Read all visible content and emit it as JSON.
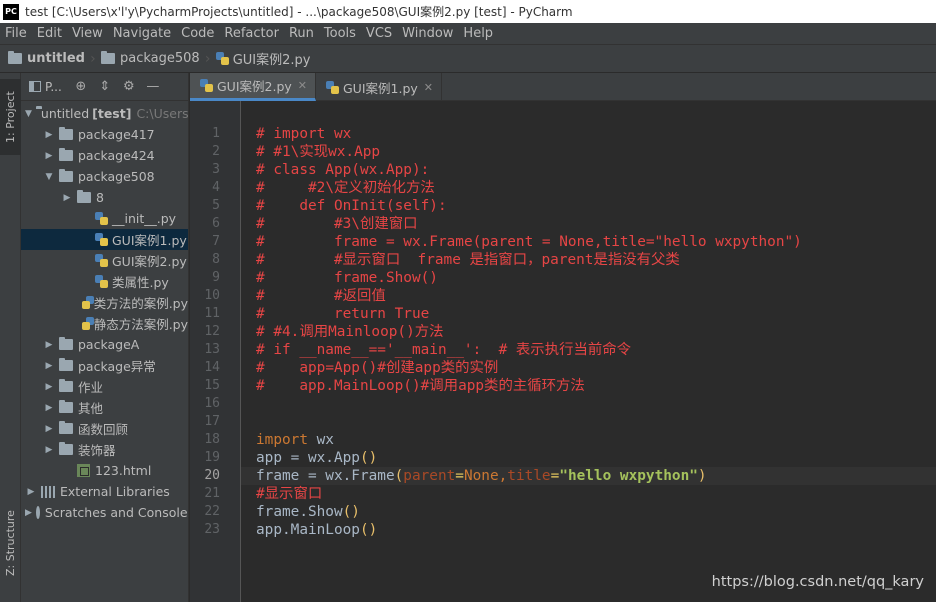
{
  "window": {
    "title": "test [C:\\Users\\x'l'y\\PycharmProjects\\untitled] - ...\\package508\\GUI案例2.py [test] - PyCharm",
    "app_icon_text": "PC"
  },
  "menu": [
    "File",
    "Edit",
    "View",
    "Navigate",
    "Code",
    "Refactor",
    "Run",
    "Tools",
    "VCS",
    "Window",
    "Help"
  ],
  "breadcrumb": [
    "untitled",
    "package508",
    "GUI案例2.py"
  ],
  "left_strip": {
    "project_tab": "1: Project",
    "structure_tab": "Z: Structure"
  },
  "project_panel": {
    "title": "P..."
  },
  "tree": [
    {
      "label": "untitled",
      "extra": "[test]",
      "muted": "C:\\Users",
      "indent": 0,
      "arrow": "down",
      "icon": "folder"
    },
    {
      "label": "package417",
      "indent": 1,
      "arrow": "right",
      "icon": "folder"
    },
    {
      "label": "package424",
      "indent": 1,
      "arrow": "right",
      "icon": "folder"
    },
    {
      "label": "package508",
      "indent": 1,
      "arrow": "down",
      "icon": "folder"
    },
    {
      "label": "8",
      "indent": 2,
      "arrow": "right",
      "icon": "folder"
    },
    {
      "label": "__init__.py",
      "indent": 3,
      "arrow": "",
      "icon": "py"
    },
    {
      "label": "GUI案例1.py",
      "indent": 3,
      "arrow": "",
      "icon": "py",
      "selected": true
    },
    {
      "label": "GUI案例2.py",
      "indent": 3,
      "arrow": "",
      "icon": "py"
    },
    {
      "label": "类属性.py",
      "indent": 3,
      "arrow": "",
      "icon": "py"
    },
    {
      "label": "类方法的案例.py",
      "indent": 3,
      "arrow": "",
      "icon": "py"
    },
    {
      "label": "静态方法案例.py",
      "indent": 3,
      "arrow": "",
      "icon": "py"
    },
    {
      "label": "packageA",
      "indent": 1,
      "arrow": "right",
      "icon": "folder"
    },
    {
      "label": "package异常",
      "indent": 1,
      "arrow": "right",
      "icon": "folder"
    },
    {
      "label": "作业",
      "indent": 1,
      "arrow": "right",
      "icon": "folder"
    },
    {
      "label": "其他",
      "indent": 1,
      "arrow": "right",
      "icon": "folder"
    },
    {
      "label": "函数回顾",
      "indent": 1,
      "arrow": "right",
      "icon": "folder"
    },
    {
      "label": "装饰器",
      "indent": 1,
      "arrow": "right",
      "icon": "folder"
    },
    {
      "label": "123.html",
      "indent": 2,
      "arrow": "",
      "icon": "html"
    },
    {
      "label": "External Libraries",
      "indent": 0,
      "arrow": "right",
      "icon": "lib"
    },
    {
      "label": "Scratches and Consoles",
      "indent": 0,
      "arrow": "right",
      "icon": "scratch"
    }
  ],
  "editor_tabs": [
    {
      "label": "GUI案例2.py",
      "active": true
    },
    {
      "label": "GUI案例1.py",
      "active": false
    }
  ],
  "editor": {
    "current_line": 20,
    "lines": [
      [
        {
          "t": "# import wx",
          "c": "cm"
        }
      ],
      [
        {
          "t": "# #1\\实现wx.App",
          "c": "cm"
        }
      ],
      [
        {
          "t": "# class App(wx.App):",
          "c": "cm"
        }
      ],
      [
        {
          "t": "#",
          "c": "cm"
        },
        {
          "t": "     ",
          "c": "dots"
        },
        {
          "t": "#2\\定义初始化方法",
          "c": "cm"
        }
      ],
      [
        {
          "t": "#",
          "c": "cm"
        },
        {
          "t": "    ",
          "c": "dots"
        },
        {
          "t": "def OnInit(self):",
          "c": "cm"
        }
      ],
      [
        {
          "t": "#",
          "c": "cm"
        },
        {
          "t": "        ",
          "c": "dots"
        },
        {
          "t": "#3\\创建窗口",
          "c": "cm"
        }
      ],
      [
        {
          "t": "#",
          "c": "cm"
        },
        {
          "t": "        ",
          "c": "dots"
        },
        {
          "t": "frame = wx.Frame(parent = None,title=\"hello wxpython\")",
          "c": "cm"
        }
      ],
      [
        {
          "t": "#",
          "c": "cm"
        },
        {
          "t": "        ",
          "c": "dots"
        },
        {
          "t": "#显示窗口  frame 是指窗口，parent是指没有父类",
          "c": "cm"
        }
      ],
      [
        {
          "t": "#",
          "c": "cm"
        },
        {
          "t": "        ",
          "c": "dots"
        },
        {
          "t": "frame.Show()",
          "c": "cm"
        }
      ],
      [
        {
          "t": "#",
          "c": "cm"
        },
        {
          "t": "        ",
          "c": "dots"
        },
        {
          "t": "#返回值",
          "c": "cm"
        }
      ],
      [
        {
          "t": "#",
          "c": "cm"
        },
        {
          "t": "        ",
          "c": "dots"
        },
        {
          "t": "return True",
          "c": "cm"
        }
      ],
      [
        {
          "t": "# #4.调用Mainloop()方法",
          "c": "cm"
        }
      ],
      [
        {
          "t": "# if __name__=='__main__':  # 表示执行当前命令",
          "c": "cm"
        }
      ],
      [
        {
          "t": "#",
          "c": "cm"
        },
        {
          "t": "    ",
          "c": "dots"
        },
        {
          "t": "app=App()#创建app类的实例",
          "c": "cm"
        }
      ],
      [
        {
          "t": "#",
          "c": "cm"
        },
        {
          "t": "    ",
          "c": "dots"
        },
        {
          "t": "app.MainLoop()#调用app类的主循环方法",
          "c": "cm"
        }
      ],
      [],
      [],
      [
        {
          "t": "import",
          "c": "kw"
        },
        {
          "t": " wx",
          "c": ""
        }
      ],
      [
        {
          "t": "app = wx.App",
          "c": ""
        },
        {
          "t": "()",
          "c": "paren"
        }
      ],
      [
        {
          "t": "frame = wx.Frame",
          "c": ""
        },
        {
          "t": "(",
          "c": "paren"
        },
        {
          "t": "parent",
          "c": "prm"
        },
        {
          "t": "=",
          "c": "eq"
        },
        {
          "t": "None",
          "c": "kw"
        },
        {
          "t": ",",
          "c": "kw"
        },
        {
          "t": "title",
          "c": "prm"
        },
        {
          "t": "=",
          "c": "eq"
        },
        {
          "t": "\"hello wxpython\"",
          "c": "str"
        },
        {
          "t": ")",
          "c": "paren"
        }
      ],
      [
        {
          "t": "#显示窗口",
          "c": "cm"
        }
      ],
      [
        {
          "t": "frame.Show",
          "c": ""
        },
        {
          "t": "()",
          "c": "paren"
        }
      ],
      [
        {
          "t": "app.MainLoop",
          "c": ""
        },
        {
          "t": "()",
          "c": "paren"
        }
      ]
    ]
  },
  "watermark": "https://blog.csdn.net/qq_kary"
}
